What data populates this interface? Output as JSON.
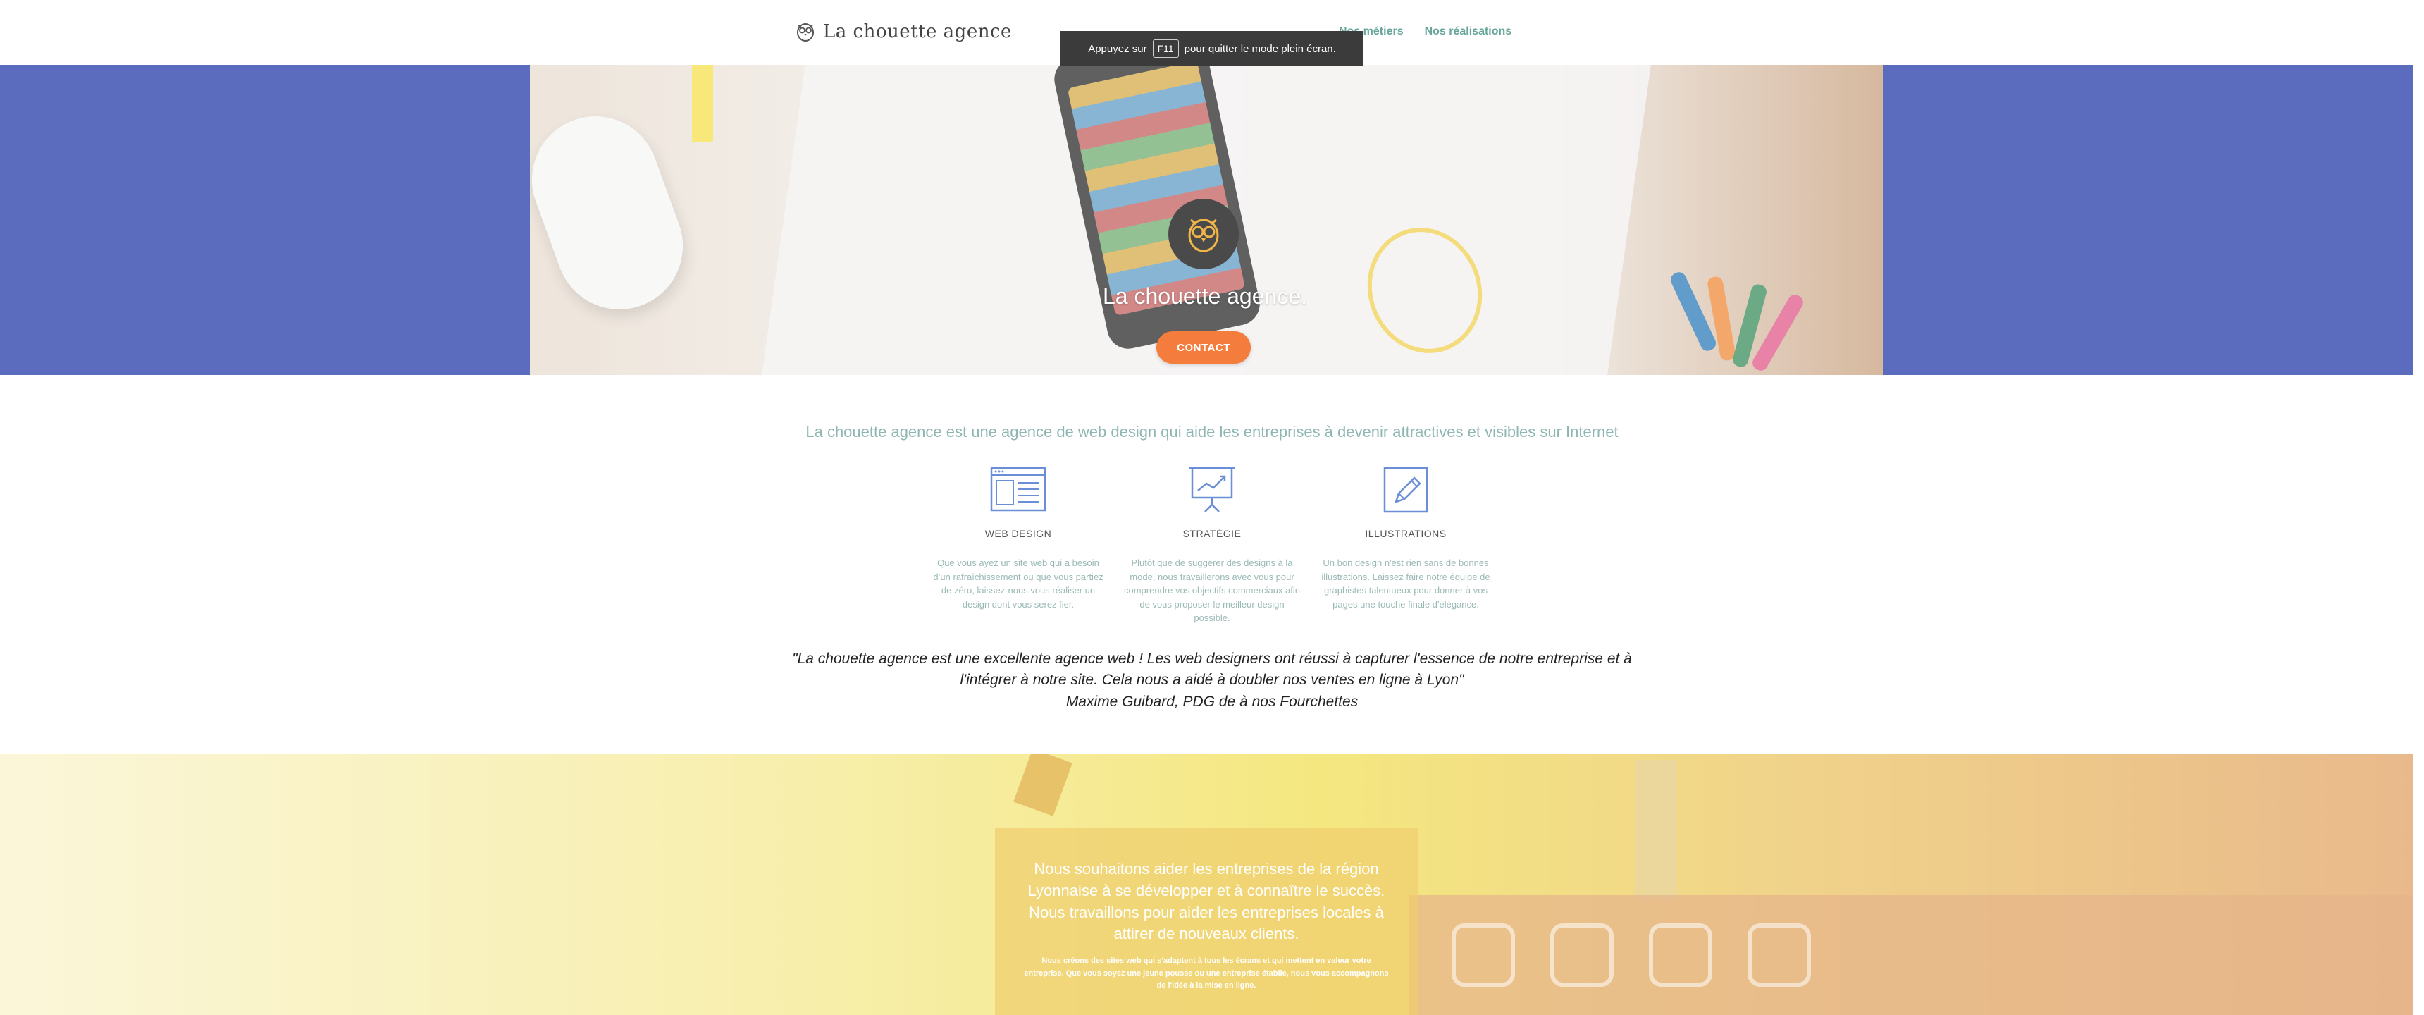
{
  "header": {
    "logo_text": "La chouette agence",
    "nav": [
      "Nos métiers",
      "Nos réalisations"
    ]
  },
  "fullscreen_tip": {
    "before": "Appuyez sur",
    "key": "F11",
    "after": "pour quitter le mode plein écran."
  },
  "hero": {
    "title": "La chouette agence.",
    "cta": "CONTACT"
  },
  "intro": {
    "text": "La chouette agence est une agence de web design qui aide les entreprises à devenir attractives et visibles sur Internet"
  },
  "services": [
    {
      "icon": "browser-window-icon",
      "title": "WEB DESIGN",
      "text": "Que vous ayez un site web qui a besoin d’un rafraîchissement ou que vous partiez de zéro, laissez-nous vous réaliser un design dont vous serez fier."
    },
    {
      "icon": "presentation-chart-icon",
      "title": "STRATÉGIE",
      "text": "Plutôt que de suggérer des designs à la mode, nous travaillerons avec vous pour comprendre vos objectifs commerciaux afin de vous proposer le meilleur design possible."
    },
    {
      "icon": "pencil-drawing-icon",
      "title": "ILLUSTRATIONS",
      "text": "Un bon design n'est rien sans de bonnes illustrations. Laissez faire notre équipe de graphistes talentueux pour donner à vos pages une touche finale d'élégance."
    }
  ],
  "testimonial": {
    "quote": "\"La chouette agence est une excellente agence web ! Les web designers ont réussi à capturer l'essence de notre entreprise et à l'intégrer à notre site. Cela nous a aidé à doubler nos ventes en ligne à Lyon\"",
    "author": "Maxime Guibard, PDG de à nos Fourchettes"
  },
  "mission": {
    "title": "Nous souhaitons aider les entreprises de la région Lyonnaise à se développer et à connaître le succès. Nous travaillons pour aider les entreprises locales à attirer de nouveaux clients.",
    "text": "Nous créons des sites web qui s'adaptent à tous les écrans et qui mettent en valeur votre entreprise. Que vous soyez une jeune pousse ou une entreprise établie, nous vous accompagnons de l'idée à la mise en ligne."
  },
  "colors": {
    "hero_bg": "#5b6bbd",
    "accent_orange": "#f47c3c",
    "nav_green": "#67a59a",
    "intro_text": "#8fb7b2",
    "service_text": "#9bbab6"
  }
}
